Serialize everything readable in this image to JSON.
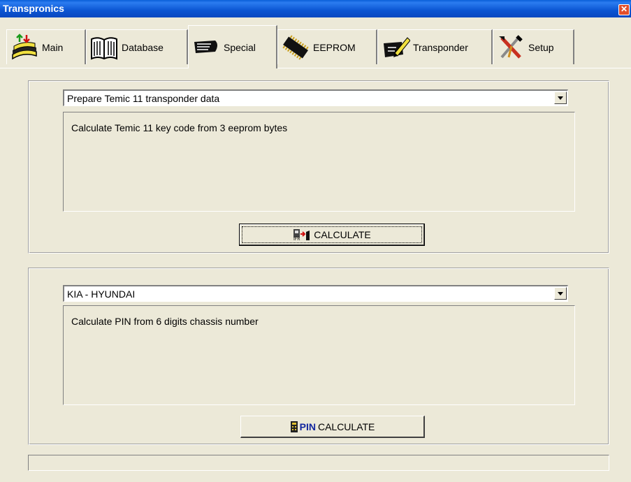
{
  "window": {
    "title": "Transpronics",
    "close_glyph": "✕"
  },
  "tabs": [
    {
      "label": "Main",
      "icon": "main-icon"
    },
    {
      "label": "Database",
      "icon": "book-icon"
    },
    {
      "label": "Special",
      "icon": "special-icon"
    },
    {
      "label": "EEPROM",
      "icon": "chip-icon"
    },
    {
      "label": "Transponder",
      "icon": "pen-icon"
    },
    {
      "label": "Setup",
      "icon": "tools-icon"
    }
  ],
  "active_tab": "Special",
  "panel1": {
    "combo_value": "Prepare Temic 11 transponder data",
    "description": "Calculate Temic 11 key code from 3 eeprom bytes",
    "button_label": "CALCULATE",
    "button_icon": "transponder-to-key-icon"
  },
  "panel2": {
    "combo_value": "KIA - HYUNDAI",
    "description": "Calculate PIN from 6 digits chassis number",
    "button_pin_word": "PIN",
    "button_label": "CALCULATE",
    "button_icon": "pin-keypad-icon"
  },
  "status_text": ""
}
